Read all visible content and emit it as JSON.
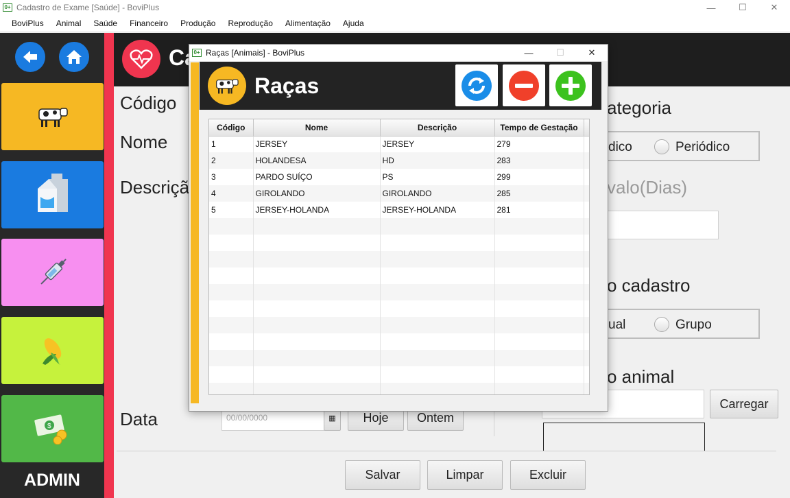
{
  "window": {
    "title": "Cadastro de Exame [Saúde] - BoviPlus",
    "app_badge": "0+"
  },
  "menu": [
    "BoviPlus",
    "Animal",
    "Saúde",
    "Financeiro",
    "Produção",
    "Reprodução",
    "Alimentação",
    "Ajuda"
  ],
  "sidebar": {
    "tiles": [
      {
        "name": "animal",
        "color": "#f6b823"
      },
      {
        "name": "milk",
        "color": "#1a7be0"
      },
      {
        "name": "health",
        "color": "#f78ff0"
      },
      {
        "name": "food",
        "color": "#c6f23c"
      },
      {
        "name": "finance",
        "color": "#52b848"
      }
    ],
    "admin_label": "ADMIN"
  },
  "form": {
    "title_partial": "Ca",
    "codigo": "Código",
    "nome": "Nome",
    "descricao": "Descriçã",
    "data": "Data",
    "data_placeholder": "00/00/0000",
    "hoje": "Hoje",
    "ontem": "Ontem",
    "categoria": "ategoria",
    "cat_option1": "dico",
    "cat_option2": "Periódico",
    "intervalo": "valo(Dias)",
    "cadastro": "o cadastro",
    "cad_option1": "ual",
    "cad_option2": "Grupo",
    "animal": "o animal",
    "carregar": "Carregar",
    "salvar": "Salvar",
    "limpar": "Limpar",
    "excluir": "Excluir"
  },
  "modal": {
    "window_title": "Raças [Animais] - BoviPlus",
    "title": "Raças",
    "columns": [
      "Código",
      "Nome",
      "Descrição",
      "Tempo de Gestação"
    ],
    "rows": [
      [
        "1",
        "JERSEY",
        "JERSEY",
        "279"
      ],
      [
        "2",
        "HOLANDESA",
        "HD",
        "283"
      ],
      [
        "3",
        "PARDO SUÍÇO",
        "PS",
        "299"
      ],
      [
        "4",
        "GIROLANDO",
        "GIROLANDO",
        "285"
      ],
      [
        "5",
        "JERSEY-HOLANDA",
        "JERSEY-HOLANDA",
        "281"
      ]
    ]
  }
}
